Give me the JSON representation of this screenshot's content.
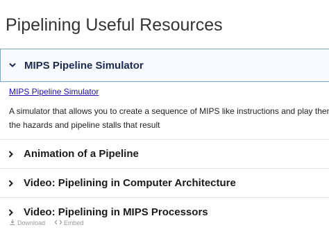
{
  "page": {
    "title": "Pipelining Useful Resources"
  },
  "accordion": {
    "items": [
      {
        "title": "MIPS Pipeline Simulator",
        "link_text": "MIPS Pipeline Simulator",
        "description_line1": "A simulator that allows you to create a sequence of MIPS like instructions and play them t",
        "description_line2": "the hazards and pipeline stalls that result",
        "expanded": true
      },
      {
        "title": "Animation of a Pipeline",
        "expanded": false
      },
      {
        "title": "Video: Pipelining in Computer Architecture",
        "expanded": false
      },
      {
        "title": "Video: Pipelining in MIPS Processors",
        "expanded": false
      }
    ]
  },
  "footer": {
    "download_label": "Download",
    "embed_label": "Embed"
  },
  "colors": {
    "accent_border": "#7fa6cf",
    "link": "#1a0dab",
    "open_title": "#1b2a4e"
  },
  "icons": {
    "expanded": "chevron-down-icon",
    "collapsed": "chevron-right-icon",
    "download": "download-icon",
    "embed": "code-icon"
  }
}
